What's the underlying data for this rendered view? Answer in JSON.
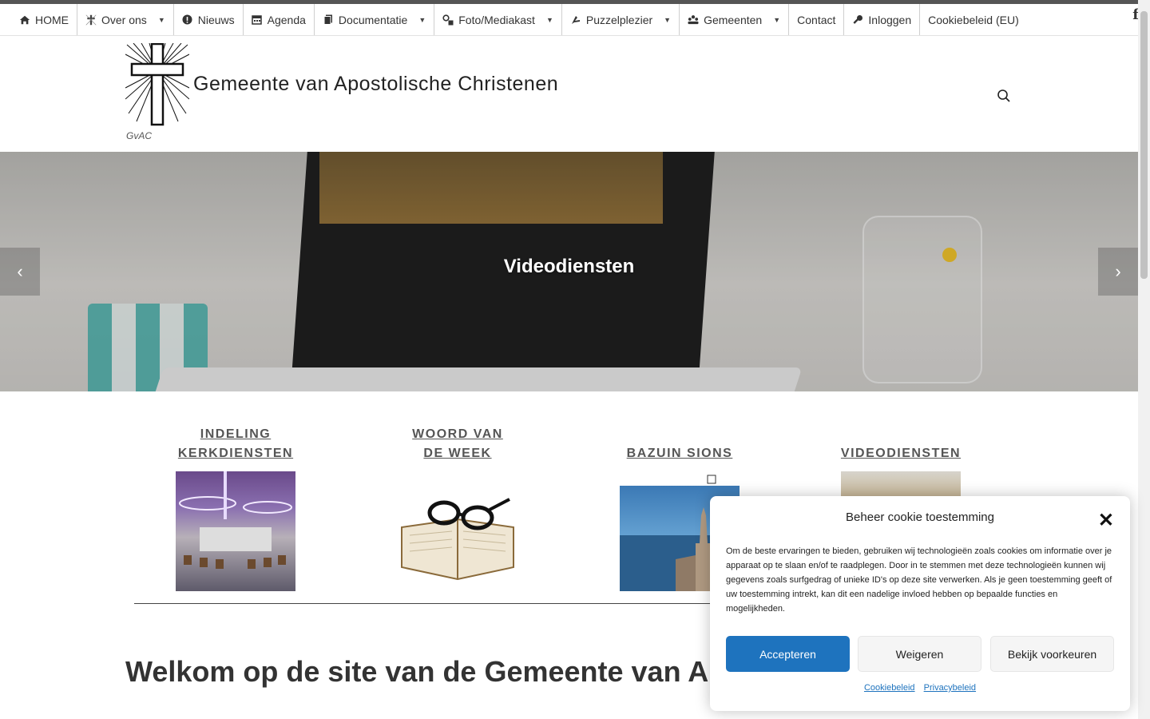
{
  "nav": {
    "items": [
      {
        "label": "HOME",
        "icon": "home-icon",
        "has_dropdown": false
      },
      {
        "label": "Over ons",
        "icon": "cross-logo-icon",
        "has_dropdown": true
      },
      {
        "label": "Nieuws",
        "icon": "exclamation-icon",
        "has_dropdown": false
      },
      {
        "label": "Agenda",
        "icon": "calendar-icon",
        "has_dropdown": false
      },
      {
        "label": "Documentatie",
        "icon": "documents-icon",
        "has_dropdown": true
      },
      {
        "label": "Foto/Mediakast",
        "icon": "media-icon",
        "has_dropdown": true
      },
      {
        "label": "Puzzelplezier",
        "icon": "puzzle-icon",
        "has_dropdown": true
      },
      {
        "label": "Gemeenten",
        "icon": "people-icon",
        "has_dropdown": true
      },
      {
        "label": "Contact",
        "icon": "",
        "has_dropdown": false
      },
      {
        "label": "Inloggen",
        "icon": "key-icon",
        "has_dropdown": false
      },
      {
        "label": "Cookiebeleid (EU)",
        "icon": "",
        "has_dropdown": false
      }
    ],
    "social_icon": "facebook-icon"
  },
  "header": {
    "site_title": "Gemeente van Apostolische Christenen",
    "tagline": "GvAC",
    "search_icon": "search-icon"
  },
  "hero": {
    "caption": "Videodiensten"
  },
  "features": [
    {
      "title_line1": "INDELING",
      "title_line2": "KERKDIENSTEN"
    },
    {
      "title_line1": "WOORD VAN",
      "title_line2": "DE WEEK"
    },
    {
      "title_line1": "BAZUIN SIONS",
      "title_line2": ""
    },
    {
      "title_line1": "VIDEODIENSTEN",
      "title_line2": ""
    }
  ],
  "welcome_text": "Welkom op de site van de Gemeente van Apostolische Christenen",
  "cookie": {
    "title": "Beheer cookie toestemming",
    "body": "Om de beste ervaringen te bieden, gebruiken wij technologieën zoals cookies om informatie over je apparaat op te slaan en/of te raadplegen. Door in te stemmen met deze technologieën kunnen wij gegevens zoals surfgedrag of unieke ID's op deze site verwerken. Als je geen toestemming geeft of uw toestemming intrekt, kan dit een nadelige invloed hebben op bepaalde functies en mogelijkheden.",
    "accept": "Accepteren",
    "deny": "Weigeren",
    "prefs": "Bekijk voorkeuren",
    "link1": "Cookiebeleid",
    "link2": "Privacybeleid"
  },
  "colors": {
    "accent": "#1e73be",
    "text": "#333333"
  }
}
